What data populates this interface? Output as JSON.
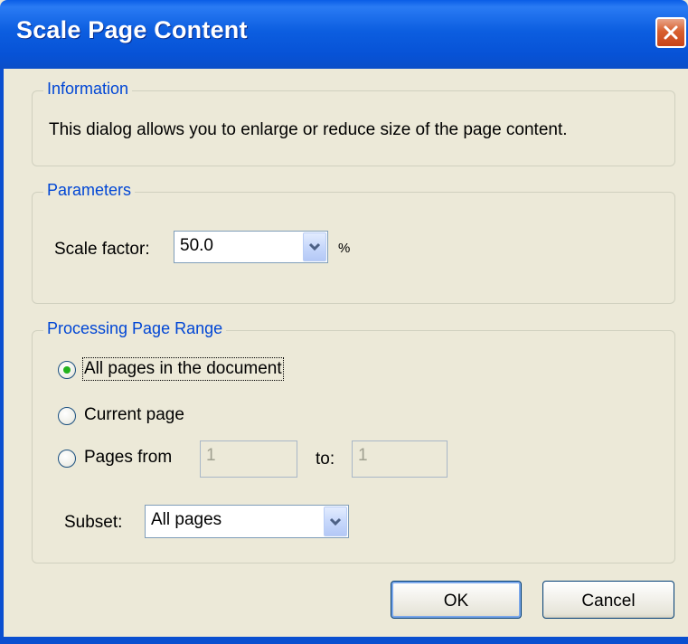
{
  "window": {
    "title": "Scale Page Content",
    "close_icon": "close-icon"
  },
  "information": {
    "legend": "Information",
    "text": "This dialog allows you to enlarge or reduce size of the page content."
  },
  "parameters": {
    "legend": "Parameters",
    "scale_label": "Scale factor:",
    "scale_value": "50.0",
    "unit": "%"
  },
  "range": {
    "legend": "Processing Page Range",
    "options": [
      {
        "label": "All pages in the document",
        "selected": true
      },
      {
        "label": "Current page",
        "selected": false
      },
      {
        "label": "Pages from",
        "selected": false
      }
    ],
    "from_value": "1",
    "to_label": "to:",
    "to_value": "1",
    "subset_label": "Subset:",
    "subset_value": "All pages"
  },
  "buttons": {
    "ok": "OK",
    "cancel": "Cancel"
  },
  "colors": {
    "title_bar": "#0a5de6",
    "dialog_bg": "#ece9d8",
    "legend_text": "#0046d5",
    "close_button": "#d8602f"
  }
}
